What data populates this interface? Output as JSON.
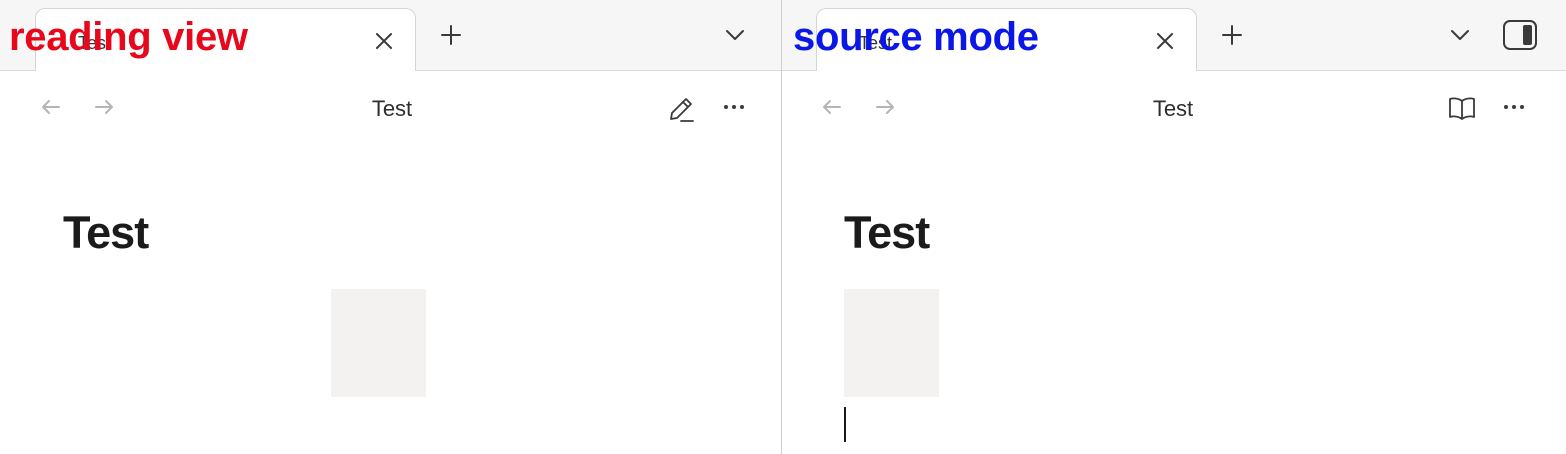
{
  "colors": {
    "reading_label": "#e8081c",
    "source_label": "#0a17e6"
  },
  "reading_view": {
    "overlay_label": "reading view",
    "tab": {
      "title": "Test",
      "close_icon": "close-icon"
    },
    "new_tab_icon": "plus-icon",
    "tab_list_icon": "chevron-down-icon",
    "nav": {
      "back_icon": "arrow-left-icon",
      "forward_icon": "arrow-right-icon"
    },
    "view_title": "Test",
    "mode_toggle_icon": "pencil-icon",
    "more_icon": "more-horizontal-icon",
    "content": {
      "heading": "Test",
      "image": "embedded-image"
    }
  },
  "source_mode": {
    "overlay_label": "source mode",
    "tab": {
      "title": "Test",
      "close_icon": "close-icon"
    },
    "new_tab_icon": "plus-icon",
    "tab_list_icon": "chevron-down-icon",
    "sidebar_toggle_icon": "sidebar-toggle-icon",
    "nav": {
      "back_icon": "arrow-left-icon",
      "forward_icon": "arrow-right-icon"
    },
    "view_title": "Test",
    "mode_toggle_icon": "book-open-icon",
    "more_icon": "more-horizontal-icon",
    "content": {
      "heading": "Test",
      "image": "embedded-image"
    }
  }
}
